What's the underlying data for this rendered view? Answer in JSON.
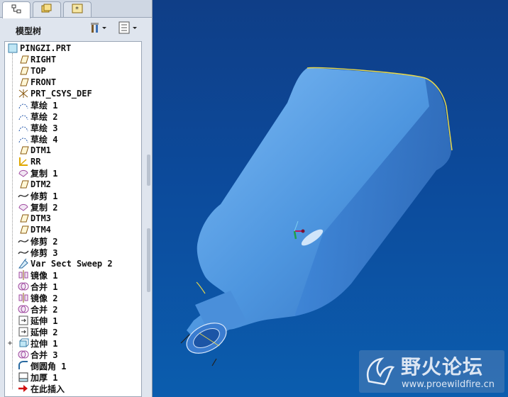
{
  "colors": {
    "accent": "#3b82f6",
    "model": "#5aa0e8",
    "bg_top": "#0f3e87",
    "bg_bottom": "#0b5dae"
  },
  "tabs": [
    {
      "icon": "model-tree-tab-icon"
    },
    {
      "icon": "folder-tab-icon"
    },
    {
      "icon": "favorites-tab-icon"
    }
  ],
  "header": {
    "title": "模型树",
    "tools_icon": "tree-settings-icon",
    "columns_icon": "tree-columns-icon"
  },
  "tree": {
    "items": [
      {
        "label": "PINGZI.PRT",
        "icon": "part-icon"
      },
      {
        "label": "RIGHT",
        "icon": "datum-plane-icon"
      },
      {
        "label": "TOP",
        "icon": "datum-plane-icon"
      },
      {
        "label": "FRONT",
        "icon": "datum-plane-icon"
      },
      {
        "label": "PRT_CSYS_DEF",
        "icon": "csys-icon"
      },
      {
        "label": "草绘 1",
        "icon": "sketch-icon"
      },
      {
        "label": "草绘 2",
        "icon": "sketch-icon"
      },
      {
        "label": "草绘 3",
        "icon": "sketch-icon"
      },
      {
        "label": "草绘 4",
        "icon": "sketch-icon"
      },
      {
        "label": "DTM1",
        "icon": "datum-plane-icon"
      },
      {
        "label": "RR",
        "icon": "rr-csys-icon"
      },
      {
        "label": "复制 1",
        "icon": "copy-icon"
      },
      {
        "label": "DTM2",
        "icon": "datum-plane-icon"
      },
      {
        "label": "修剪 1",
        "icon": "trim-icon"
      },
      {
        "label": "复制 2",
        "icon": "copy-icon"
      },
      {
        "label": "DTM3",
        "icon": "datum-plane-icon"
      },
      {
        "label": "DTM4",
        "icon": "datum-plane-icon"
      },
      {
        "label": "修剪 2",
        "icon": "trim-icon"
      },
      {
        "label": "修剪 3",
        "icon": "trim-icon"
      },
      {
        "label": "Var Sect Sweep 2",
        "icon": "sweep-icon"
      },
      {
        "label": "镜像 1",
        "icon": "mirror-icon"
      },
      {
        "label": "合并 1",
        "icon": "merge-icon"
      },
      {
        "label": "镜像 2",
        "icon": "mirror-icon"
      },
      {
        "label": "合并 2",
        "icon": "merge-icon"
      },
      {
        "label": "延伸 1",
        "icon": "extend-icon"
      },
      {
        "label": "延伸 2",
        "icon": "extend-icon"
      },
      {
        "label": "拉伸 1",
        "icon": "extrude-icon"
      },
      {
        "label": "合并 3",
        "icon": "merge-icon"
      },
      {
        "label": "倒圆角 1",
        "icon": "round-icon"
      },
      {
        "label": "加厚 1",
        "icon": "thicken-icon"
      },
      {
        "label": "在此插入",
        "icon": "insert-here-arrow-icon"
      }
    ]
  },
  "watermark": {
    "title": "野火论坛",
    "url": "www.proewildfire.cn"
  }
}
